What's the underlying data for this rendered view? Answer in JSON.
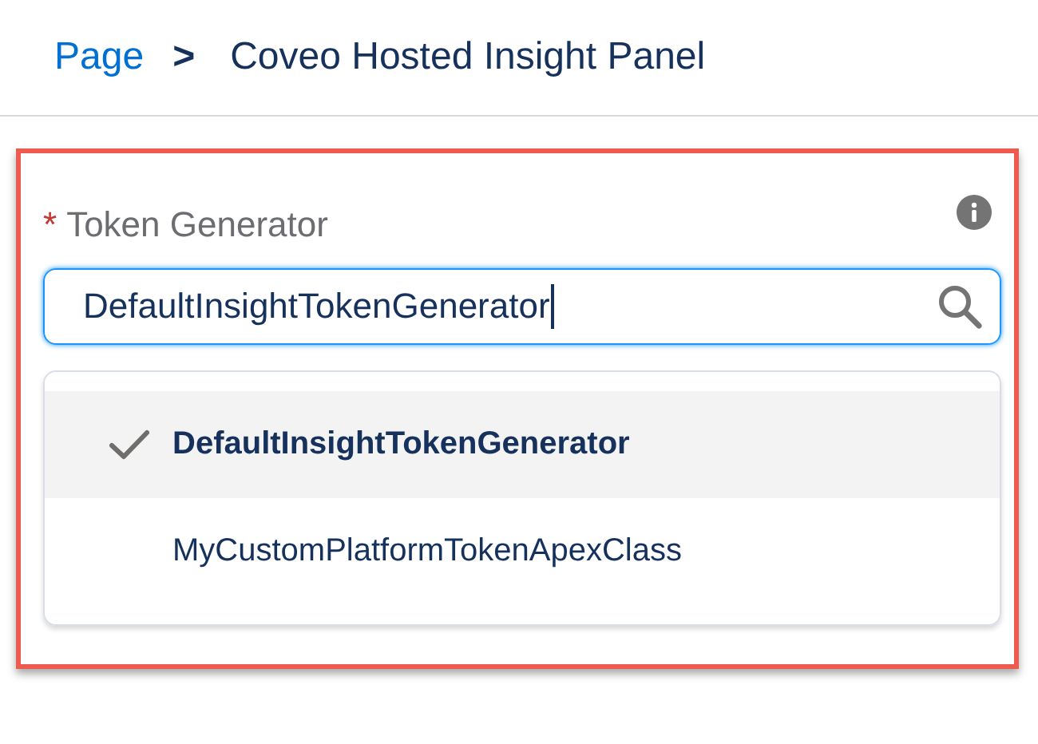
{
  "breadcrumb": {
    "link": "Page",
    "separator": ">",
    "current": "Coveo Hosted Insight Panel"
  },
  "field": {
    "required_mark": "*",
    "label": "Token Generator",
    "value": "DefaultInsightTokenGenerator"
  },
  "options": [
    {
      "label": "DefaultInsightTokenGenerator",
      "selected": true
    },
    {
      "label": "MyCustomPlatformTokenApexClass",
      "selected": false
    }
  ]
}
